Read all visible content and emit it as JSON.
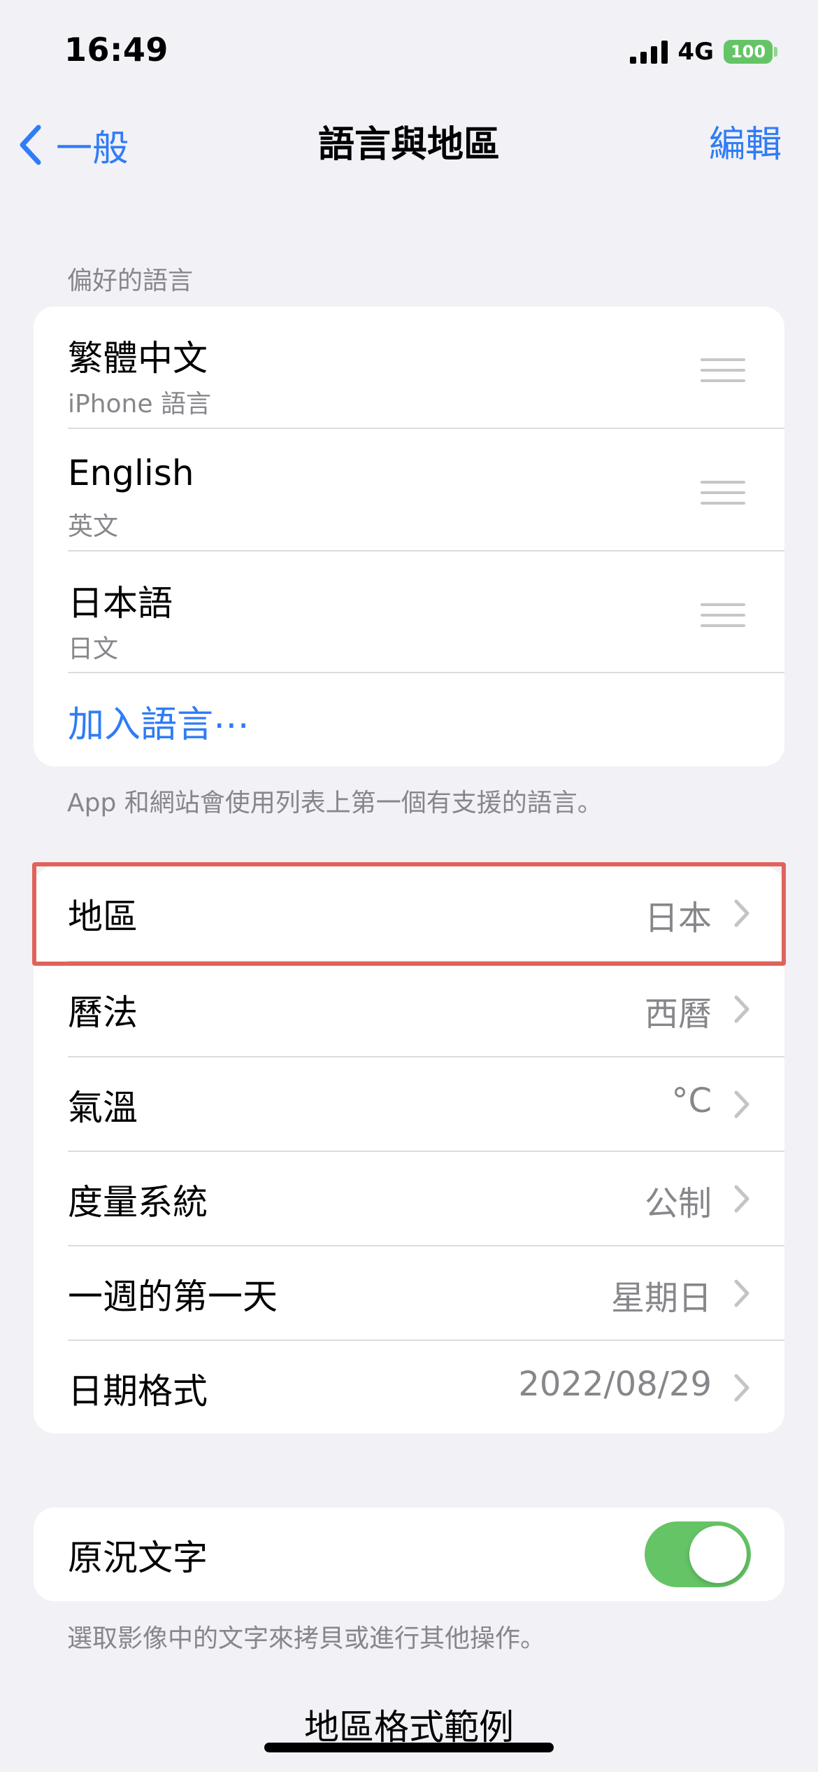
{
  "status_bar": {
    "time": "16:49",
    "network": "4G",
    "battery": "100"
  },
  "nav": {
    "back_label": "一般",
    "title": "語言與地區",
    "edit_label": "編輯"
  },
  "preferred_languages": {
    "header": "偏好的語言",
    "items": [
      {
        "name": "繁體中文",
        "subtitle": "iPhone 語言"
      },
      {
        "name": "English",
        "subtitle": "英文"
      },
      {
        "name": "日本語",
        "subtitle": "日文"
      }
    ],
    "add_label": "加入語言⋯",
    "footer": "App 和網站會使用列表上第一個有支援的語言。"
  },
  "region_settings": {
    "items": [
      {
        "label": "地區",
        "value": "日本"
      },
      {
        "label": "曆法",
        "value": "西曆"
      },
      {
        "label": "氣溫",
        "value": "°C"
      },
      {
        "label": "度量系統",
        "value": "公制"
      },
      {
        "label": "一週的第一天",
        "value": "星期日"
      },
      {
        "label": "日期格式",
        "value": "2022/08/29"
      }
    ]
  },
  "live_text": {
    "label": "原況文字",
    "enabled": true,
    "footer": "選取影像中的文字來拷貝或進行其他操作。"
  },
  "region_format_example": {
    "title": "地區格式範例"
  },
  "colors": {
    "accent": "#2f7cf6",
    "toggle_on": "#65c466",
    "highlight": "#e0635a",
    "background": "#f2f1f6"
  }
}
